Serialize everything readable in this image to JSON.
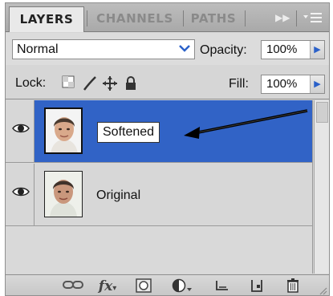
{
  "tabs": [
    {
      "label": "LAYERS",
      "active": true
    },
    {
      "label": "CHANNELS",
      "active": false
    },
    {
      "label": "PATHS",
      "active": false
    }
  ],
  "tab_icons": [
    "collapse-icon",
    "panel-menu-icon"
  ],
  "blend_mode": {
    "value": "Normal"
  },
  "opacity": {
    "label": "Opacity:",
    "value": "100%"
  },
  "lock": {
    "label": "Lock:",
    "icons": [
      "lock-transparent-pixels-icon",
      "lock-image-pixels-icon",
      "lock-position-icon",
      "lock-all-icon"
    ]
  },
  "fill": {
    "label": "Fill:",
    "value": "100%"
  },
  "layers": [
    {
      "name": "Softened",
      "visible": true,
      "selected": true,
      "editing_name": true
    },
    {
      "name": "Original",
      "visible": true,
      "selected": false,
      "editing_name": false
    }
  ],
  "annotation": {
    "arrow_color": "#000000"
  },
  "bottom_bar_icons": [
    "link-layers-icon",
    "fx-icon",
    "add-mask-icon",
    "adjustment-layer-icon",
    "new-group-icon",
    "new-layer-icon",
    "trash-icon"
  ],
  "colors": {
    "selection": "#3163c6",
    "arrow_blue": "#2b61c9"
  }
}
